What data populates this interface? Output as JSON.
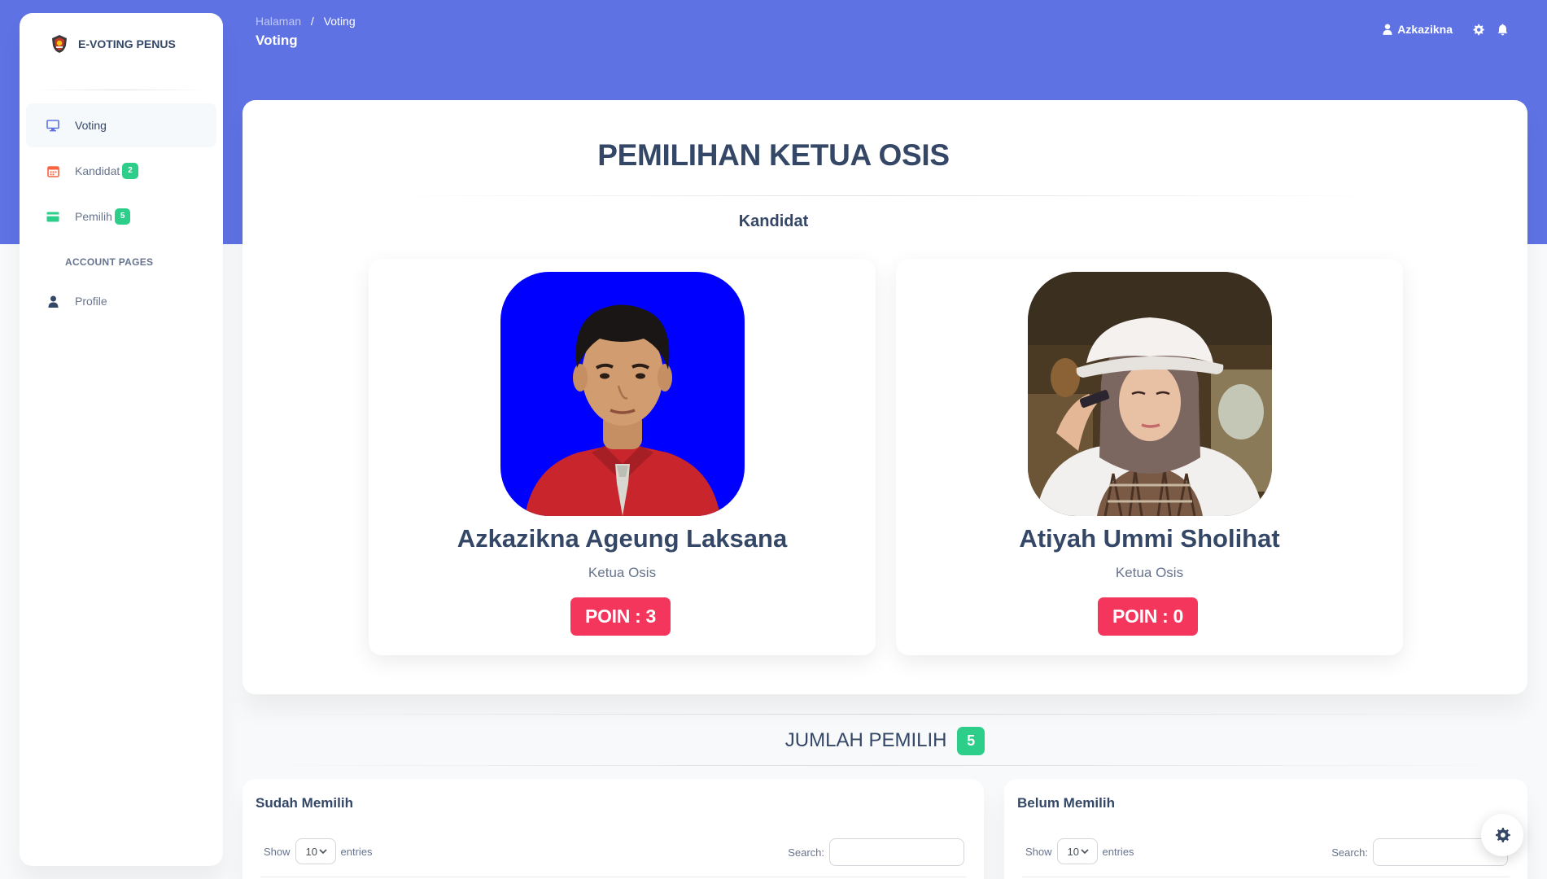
{
  "brand": {
    "name": "E-VOTING PENUS",
    "logo_icon": "emblem-icon"
  },
  "sidebar": {
    "items": [
      {
        "label": "Voting",
        "icon": "monitor-icon",
        "active": true
      },
      {
        "label": "Kandidat",
        "icon": "calendar-icon",
        "badge": "2"
      },
      {
        "label": "Pemilih",
        "icon": "credit-card-icon",
        "badge": "5"
      }
    ],
    "section_title": "ACCOUNT PAGES",
    "account_items": [
      {
        "label": "Profile",
        "icon": "user-icon"
      }
    ]
  },
  "header": {
    "breadcrumb": [
      "Halaman",
      "Voting"
    ],
    "breadcrumb_sep": "/",
    "page_title": "Voting",
    "user_name": "Azkazikna"
  },
  "main": {
    "title": "PEMILIHAN KETUA OSIS",
    "subtitle": "Kandidat",
    "candidates": [
      {
        "name": "Azkazikna Ageung Laksana",
        "role": "Ketua Osis",
        "points_label": "POIN : 3",
        "points": 3
      },
      {
        "name": "Atiyah Ummi Sholihat",
        "role": "Ketua Osis",
        "points_label": "POIN : 0",
        "points": 0
      }
    ]
  },
  "voters": {
    "title": "JUMLAH PEMILIH",
    "count": "5",
    "tables": [
      {
        "title": "Sudah Memilih",
        "show_label": "Show",
        "entries_value": "10",
        "entries_label": "entries",
        "search_label": "Search:"
      },
      {
        "title": "Belum Memilih",
        "show_label": "Show",
        "entries_value": "10",
        "entries_label": "entries",
        "search_label": "Search:"
      }
    ]
  },
  "colors": {
    "primary": "#5e72e4",
    "success": "#2dce89",
    "danger": "#f5365c",
    "heading": "#344767",
    "muted": "#67748e"
  }
}
